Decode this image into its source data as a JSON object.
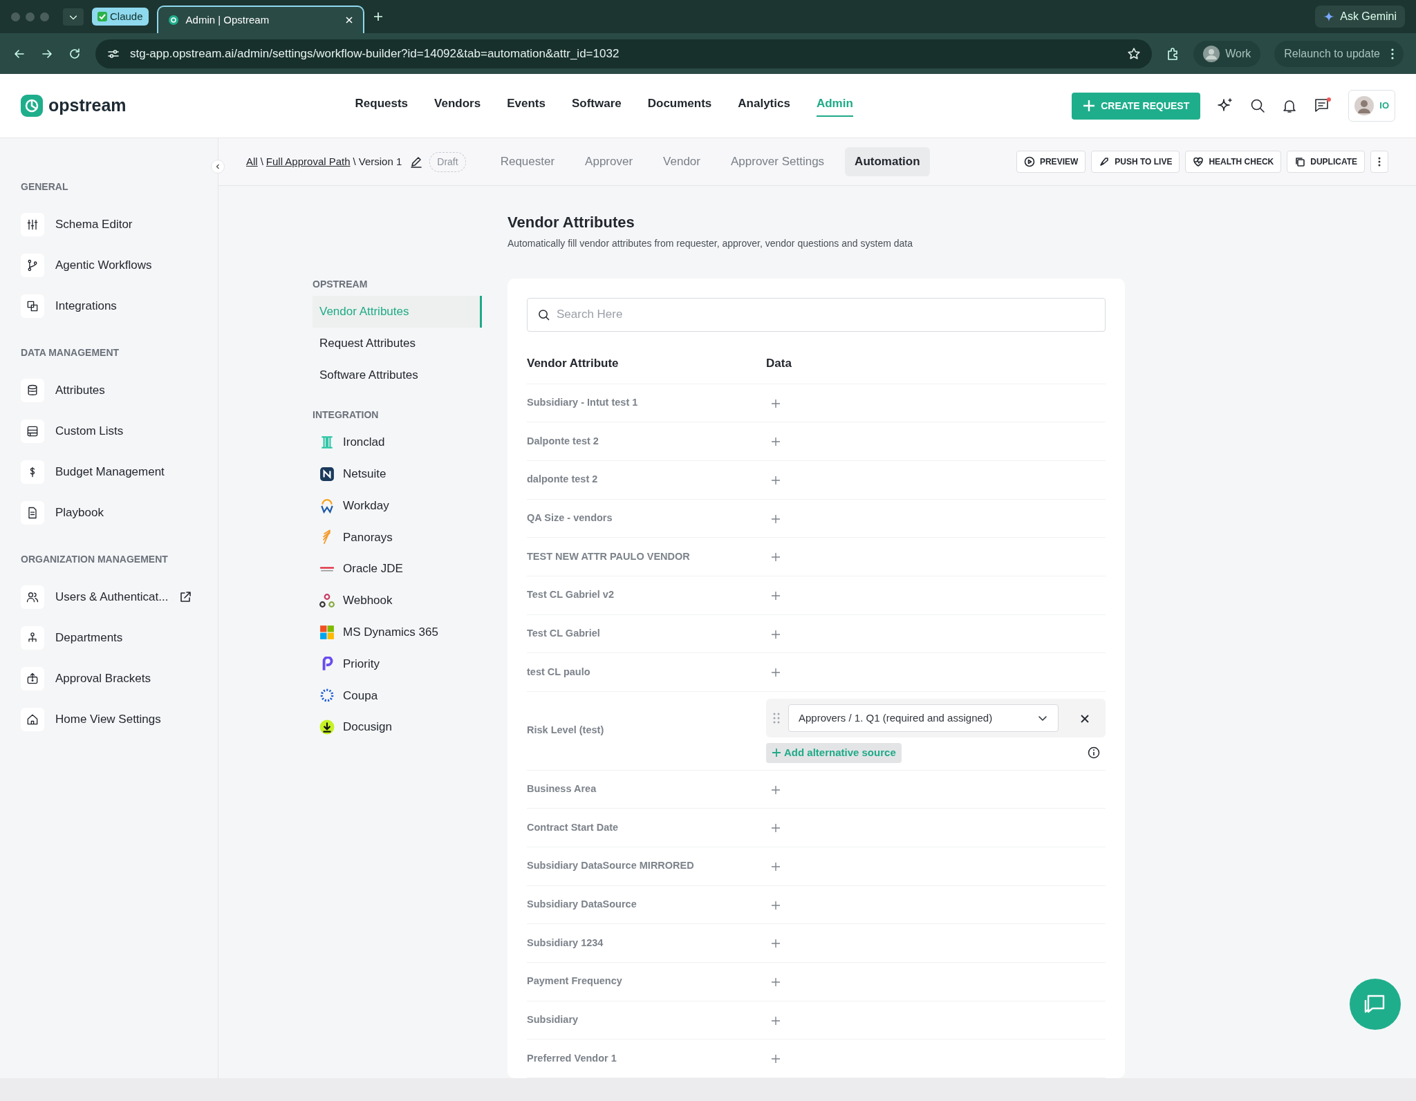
{
  "browser": {
    "tab_group": "Claude",
    "tabs": [
      {
        "label": "Admin | Opstream",
        "selected": true
      }
    ],
    "gemini": "Ask Gemini",
    "url": "stg-app.opstream.ai/admin/settings/workflow-builder?id=14092&tab=automation&attr_id=1032",
    "profile": "Work",
    "relaunch": "Relaunch to update"
  },
  "header": {
    "logo": "opstream",
    "nav": [
      {
        "label": "Requests",
        "selected": false
      },
      {
        "label": "Vendors",
        "selected": false
      },
      {
        "label": "Events",
        "selected": false
      },
      {
        "label": "Software",
        "selected": false
      },
      {
        "label": "Documents",
        "selected": false
      },
      {
        "label": "Analytics",
        "selected": false
      },
      {
        "label": "Admin",
        "selected": true
      }
    ],
    "create_button": "CREATE REQUEST",
    "org_badge": "IO"
  },
  "sidebar": {
    "sections": [
      {
        "title": "GENERAL",
        "items": [
          {
            "label": "Schema Editor",
            "external": false
          },
          {
            "label": "Agentic Workflows",
            "external": false
          },
          {
            "label": "Integrations",
            "external": false
          }
        ]
      },
      {
        "title": "DATA MANAGEMENT",
        "items": [
          {
            "label": "Attributes",
            "external": false
          },
          {
            "label": "Custom Lists",
            "external": false
          },
          {
            "label": "Budget Management",
            "external": false
          },
          {
            "label": "Playbook",
            "external": false
          }
        ]
      },
      {
        "title": "ORGANIZATION MANAGEMENT",
        "items": [
          {
            "label": "Users & Authenticat...",
            "external": true
          },
          {
            "label": "Departments",
            "external": false
          },
          {
            "label": "Approval Brackets",
            "external": false
          },
          {
            "label": "Home View Settings",
            "external": false
          }
        ]
      }
    ]
  },
  "toolbar": {
    "breadcrumb": [
      {
        "label": "All",
        "kind": "link"
      },
      {
        "label": "Full Approval Path",
        "kind": "link"
      },
      {
        "label": "Version 1",
        "kind": "current"
      }
    ],
    "separator": "\\",
    "status": "Draft",
    "tabs": [
      {
        "label": "Requester",
        "selected": false
      },
      {
        "label": "Approver",
        "selected": false
      },
      {
        "label": "Vendor",
        "selected": false
      },
      {
        "label": "Approver Settings",
        "selected": false
      },
      {
        "label": "Automation",
        "selected": true
      }
    ],
    "actions": [
      "PREVIEW",
      "PUSH TO LIVE",
      "HEALTH CHECK",
      "DUPLICATE"
    ]
  },
  "attribute_nav": [
    {
      "title": "OPSTREAM",
      "items": [
        {
          "label": "Vendor Attributes",
          "selected": true
        },
        {
          "label": "Request Attributes",
          "selected": false
        },
        {
          "label": "Software Attributes",
          "selected": false
        }
      ]
    },
    {
      "title": "INTEGRATION",
      "items": [
        {
          "label": "Ironclad",
          "selected": false
        },
        {
          "label": "Netsuite",
          "selected": false
        },
        {
          "label": "Workday",
          "selected": false
        },
        {
          "label": "Panorays",
          "selected": false
        },
        {
          "label": "Oracle JDE",
          "selected": false
        },
        {
          "label": "Webhook",
          "selected": false
        },
        {
          "label": "MS Dynamics 365",
          "selected": false
        },
        {
          "label": "Priority",
          "selected": false
        },
        {
          "label": "Coupa",
          "selected": false
        },
        {
          "label": "Docusign",
          "selected": false
        }
      ]
    }
  ],
  "main": {
    "title": "Vendor Attributes",
    "subtitle": "Automatically fill vendor attributes from requester, approver, vendor questions and system data",
    "search": {
      "placeholder": "Search Here"
    },
    "columns": [
      "Vendor Attribute",
      "Data"
    ],
    "rows": [
      {
        "name": "Subsidiary - Intut test 1",
        "kind": "empty"
      },
      {
        "name": "Dalponte test 2",
        "kind": "empty"
      },
      {
        "name": "dalponte test 2",
        "kind": "empty"
      },
      {
        "name": "QA Size - vendors",
        "kind": "empty"
      },
      {
        "name": "TEST NEW ATTR PAULO VENDOR",
        "kind": "empty"
      },
      {
        "name": "Test CL Gabriel v2",
        "kind": "empty"
      },
      {
        "name": "Test CL Gabriel",
        "kind": "empty"
      },
      {
        "name": "test CL paulo",
        "kind": "empty"
      },
      {
        "name": "Risk Level (test)",
        "kind": "mapped",
        "source": "Approvers / 1. Q1 (required and assigned)",
        "add_label": "Add alternative source"
      },
      {
        "name": "Business Area",
        "kind": "empty"
      },
      {
        "name": "Contract Start Date",
        "kind": "empty"
      },
      {
        "name": "Subsidiary DataSource MIRRORED",
        "kind": "empty"
      },
      {
        "name": "Subsidiary DataSource",
        "kind": "empty"
      },
      {
        "name": "Subsidiary 1234",
        "kind": "empty"
      },
      {
        "name": "Payment Frequency",
        "kind": "empty"
      },
      {
        "name": "Subsidiary",
        "kind": "empty"
      },
      {
        "name": "Preferred Vendor 1",
        "kind": "empty"
      }
    ]
  }
}
